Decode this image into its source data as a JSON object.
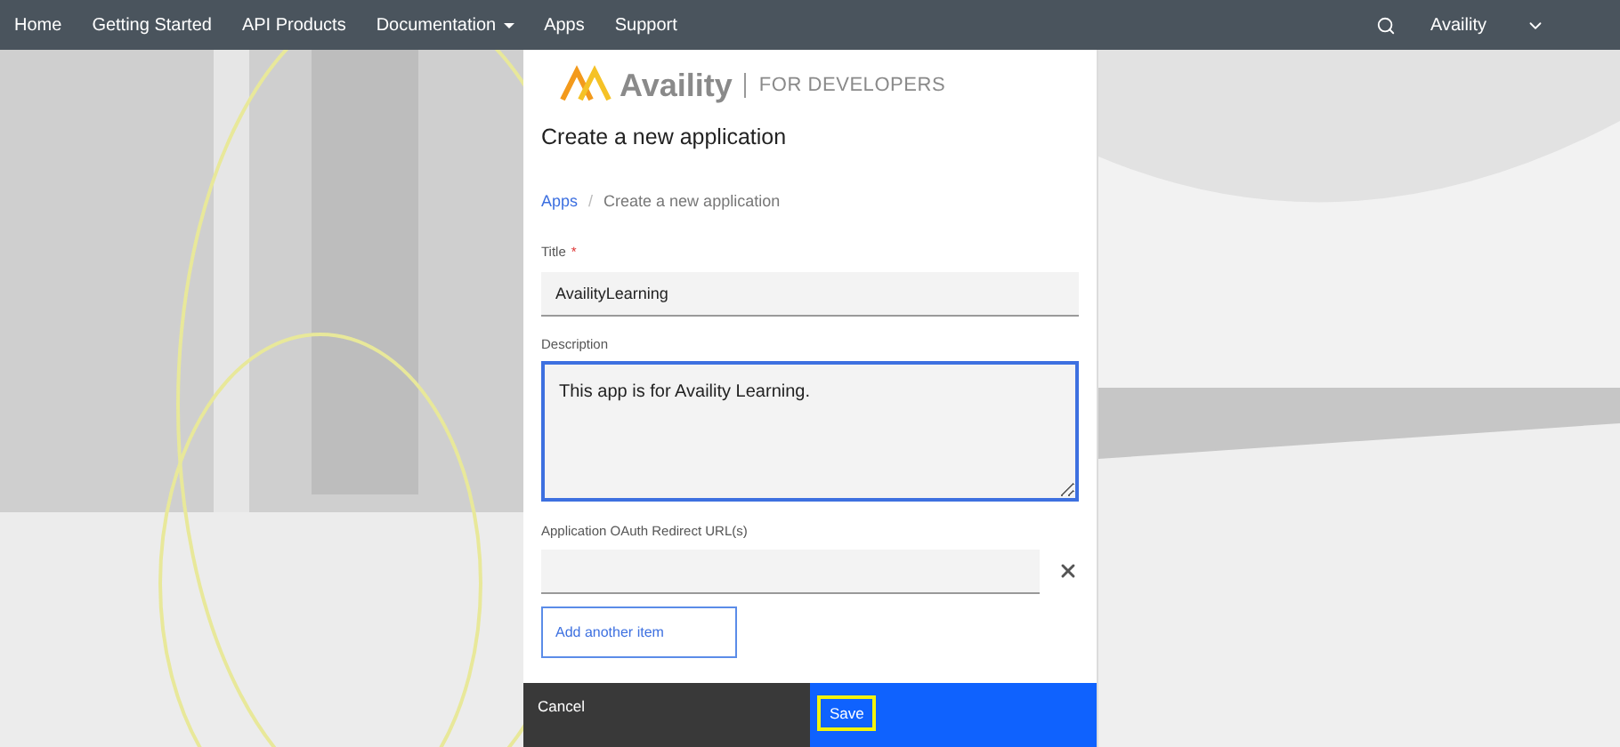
{
  "nav": {
    "items": [
      {
        "label": "Home",
        "dropdown": false
      },
      {
        "label": "Getting Started",
        "dropdown": false
      },
      {
        "label": "API Products",
        "dropdown": false
      },
      {
        "label": "Documentation",
        "dropdown": true
      },
      {
        "label": "Apps",
        "dropdown": false
      },
      {
        "label": "Support",
        "dropdown": false
      }
    ],
    "user": "Availity"
  },
  "logo": {
    "name": "Availity",
    "tagline": "FOR DEVELOPERS"
  },
  "heading": "Create a new application",
  "breadcrumb": [
    {
      "label": "Apps",
      "kind": "link"
    },
    {
      "label": "/",
      "kind": "separator"
    },
    {
      "label": "Create a new application",
      "kind": "current"
    }
  ],
  "form": {
    "title": {
      "label": "Title",
      "required_mark": "*",
      "value": "AvailityLearning",
      "focused": false
    },
    "description": {
      "label": "Description",
      "value": "This app is for Availity Learning.",
      "focused": true
    },
    "redirect": {
      "label": "Application OAuth Redirect URL(s)",
      "focused": false
    },
    "add_button": "Add another item"
  },
  "footer": {
    "cancel": "Cancel",
    "save": {
      "label": "Save",
      "focused": true
    }
  }
}
